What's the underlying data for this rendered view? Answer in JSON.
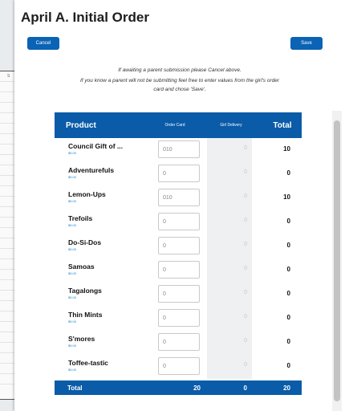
{
  "background": {
    "tag": "S"
  },
  "modal": {
    "title": "April A. Initial Order",
    "cancel_label": "Cancel",
    "save_label": "Save",
    "message_line1": "If awaiting a parent submission please Cancel above.",
    "message_line2": "If you know a parent will not be submitting feel free to enter values from the girl's order",
    "message_line3": "card and chose 'Save'."
  },
  "table": {
    "headers": {
      "product": "Product",
      "order_card": "Order Card",
      "girl_delivery": "Girl Delivery",
      "total": "Total"
    },
    "rows": [
      {
        "name": "Council Gift of ...",
        "price": "$5.00",
        "order": "010",
        "girl": "0",
        "total": "10"
      },
      {
        "name": "Adventurefuls",
        "price": "$5.00",
        "order": "0",
        "girl": "0",
        "total": "0"
      },
      {
        "name": "Lemon-Ups",
        "price": "$5.00",
        "order": "010",
        "girl": "0",
        "total": "10"
      },
      {
        "name": "Trefoils",
        "price": "$5.00",
        "order": "0",
        "girl": "0",
        "total": "0"
      },
      {
        "name": "Do-Si-Dos",
        "price": "$5.00",
        "order": "0",
        "girl": "0",
        "total": "0"
      },
      {
        "name": "Samoas",
        "price": "$5.00",
        "order": "0",
        "girl": "0",
        "total": "0"
      },
      {
        "name": "Tagalongs",
        "price": "$5.00",
        "order": "0",
        "girl": "0",
        "total": "0"
      },
      {
        "name": "Thin Mints",
        "price": "$5.00",
        "order": "0",
        "girl": "0",
        "total": "0"
      },
      {
        "name": "S'mores",
        "price": "$5.00",
        "order": "0",
        "girl": "0",
        "total": "0"
      },
      {
        "name": "Toffee-tastic",
        "price": "$5.00",
        "order": "0",
        "girl": "0",
        "total": "0"
      }
    ],
    "footer": {
      "label": "Total",
      "order": "20",
      "girl": "0",
      "total": "20"
    }
  },
  "colors": {
    "accent": "#0a5ba8",
    "button": "#0a63b5",
    "price": "#1a7fc7"
  }
}
